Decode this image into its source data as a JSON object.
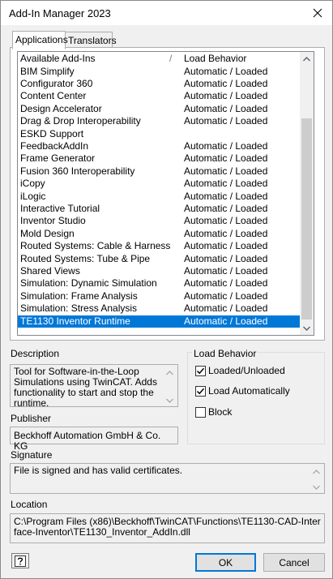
{
  "window": {
    "title": "Add-In Manager 2023"
  },
  "tabs": [
    {
      "label": "Applications"
    },
    {
      "label": "Translators"
    }
  ],
  "list": {
    "header": {
      "name": "Available Add-Ins",
      "sort_indicator": "/",
      "behavior": "Load Behavior"
    },
    "rows": [
      {
        "name": "BIM Simplify",
        "behavior": "Automatic / Loaded"
      },
      {
        "name": "Configurator 360",
        "behavior": "Automatic / Loaded"
      },
      {
        "name": "Content Center",
        "behavior": "Automatic / Loaded"
      },
      {
        "name": "Design Accelerator",
        "behavior": "Automatic / Loaded"
      },
      {
        "name": "Drag & Drop Interoperability",
        "behavior": "Automatic / Loaded"
      },
      {
        "name": "ESKD Support",
        "behavior": ""
      },
      {
        "name": "FeedbackAddIn",
        "behavior": "Automatic / Loaded"
      },
      {
        "name": "Frame Generator",
        "behavior": "Automatic / Loaded"
      },
      {
        "name": "Fusion 360 Interoperability",
        "behavior": "Automatic / Loaded"
      },
      {
        "name": "iCopy",
        "behavior": "Automatic / Loaded"
      },
      {
        "name": "iLogic",
        "behavior": "Automatic / Loaded"
      },
      {
        "name": "Interactive Tutorial",
        "behavior": "Automatic / Loaded"
      },
      {
        "name": "Inventor Studio",
        "behavior": "Automatic / Loaded"
      },
      {
        "name": "Mold Design",
        "behavior": "Automatic / Loaded"
      },
      {
        "name": "Routed Systems: Cable & Harness",
        "behavior": "Automatic / Loaded"
      },
      {
        "name": "Routed Systems: Tube & Pipe",
        "behavior": "Automatic / Loaded"
      },
      {
        "name": "Shared Views",
        "behavior": "Automatic / Loaded"
      },
      {
        "name": "Simulation: Dynamic Simulation",
        "behavior": "Automatic / Loaded"
      },
      {
        "name": "Simulation: Frame Analysis",
        "behavior": "Automatic / Loaded"
      },
      {
        "name": "Simulation: Stress Analysis",
        "behavior": "Automatic / Loaded"
      },
      {
        "name": "TE1130 Inventor Runtime",
        "behavior": "Automatic / Loaded",
        "selected": true
      }
    ]
  },
  "description": {
    "label": "Description",
    "text": "Tool for Software-in-the-Loop Simulations using TwinCAT. Adds functionality to start and stop the runtime."
  },
  "publisher": {
    "label": "Publisher",
    "text": "Beckhoff Automation GmbH & Co. KG"
  },
  "load_behavior": {
    "label": "Load Behavior",
    "options": [
      {
        "label": "Loaded/Unloaded",
        "checked": true
      },
      {
        "label": "Load Automatically",
        "checked": true
      },
      {
        "label": "Block",
        "checked": false
      }
    ]
  },
  "signature": {
    "label": "Signature",
    "text": "File is signed and has valid certificates."
  },
  "location": {
    "label": "Location",
    "text": "C:\\Program Files (x86)\\Beckhoff\\TwinCAT\\Functions\\TE1130-CAD-Interface-Inventor\\TE1130_Inventor_AddIn.dll"
  },
  "buttons": {
    "help_icon": "help-icon",
    "ok": "OK",
    "cancel": "Cancel"
  },
  "colors": {
    "selection": "#0078d7",
    "default_button_border": "#0078d7"
  }
}
